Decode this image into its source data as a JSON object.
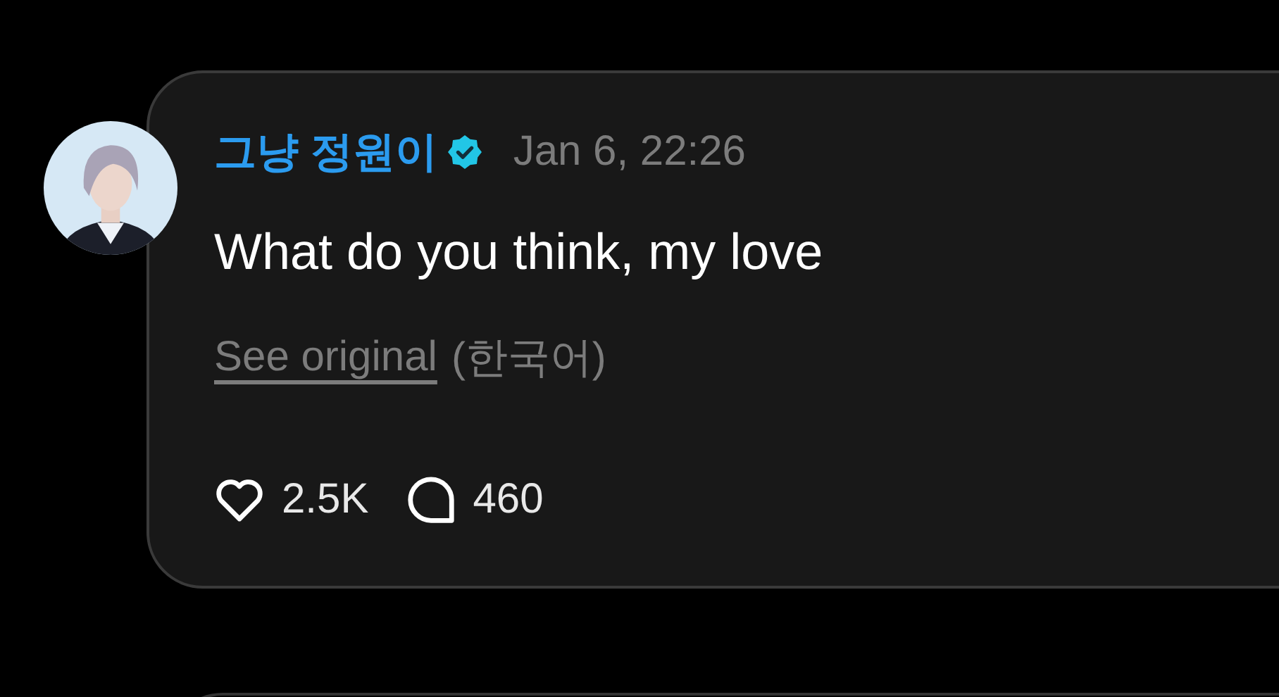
{
  "post": {
    "author": {
      "name": "그냥 정원이",
      "verified": true
    },
    "timestamp": "Jan 6, 22:26",
    "text": "What do you think, my love",
    "translation": {
      "link": "See original",
      "language": "(한국어)"
    },
    "actions": [
      {
        "kind": "like",
        "count": "2.5K"
      },
      {
        "kind": "reply",
        "count": "460"
      }
    ]
  }
}
